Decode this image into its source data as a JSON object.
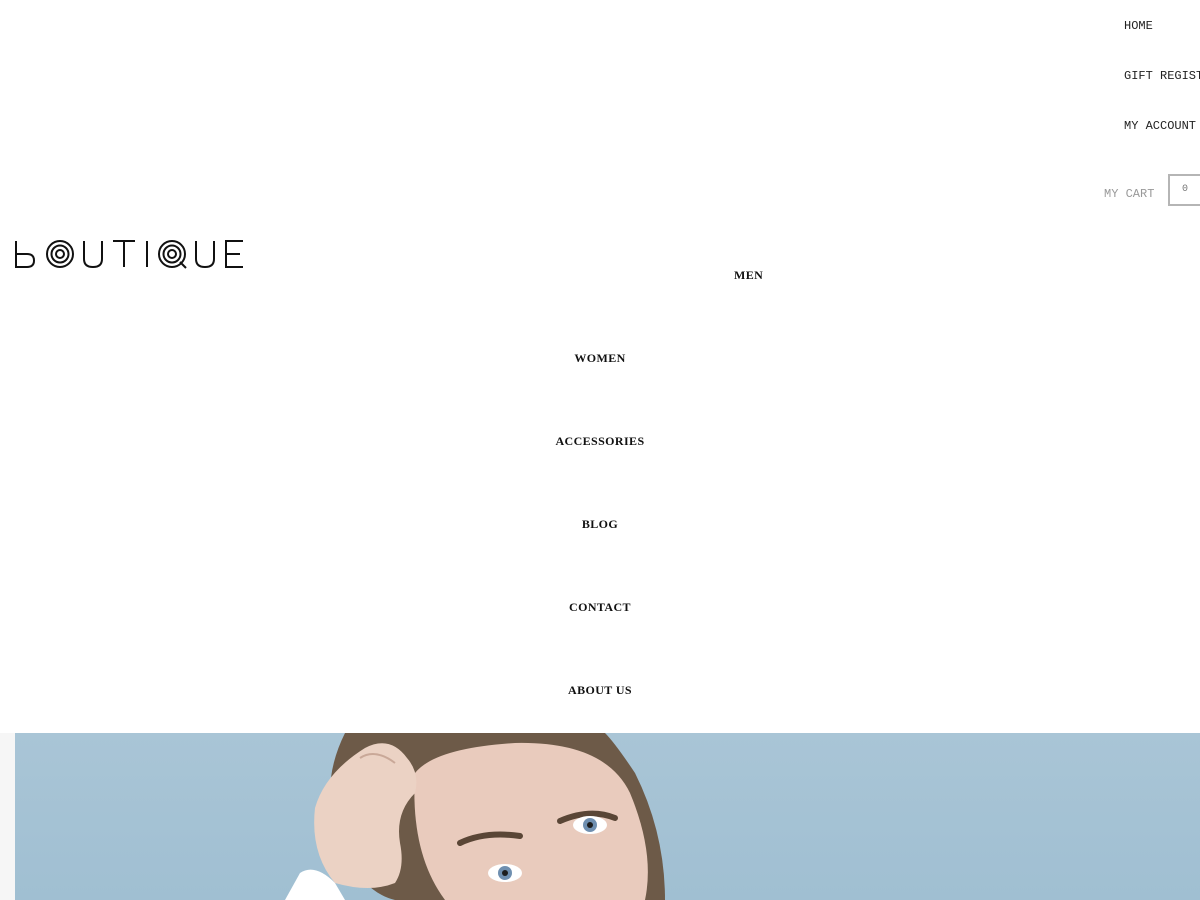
{
  "header": {
    "util_links": [
      "HOME",
      "GIFT REGISTRY",
      "MY ACCOUNT"
    ],
    "cart": {
      "label": "MY CART",
      "count": "0"
    }
  },
  "logo": {
    "text": "BOUTIQUE"
  },
  "main_nav": {
    "items": [
      "MEN",
      "WOMEN",
      "ACCESSORIES",
      "BLOG",
      "CONTACT",
      "ABOUT US"
    ]
  },
  "colors": {
    "hero_sky": "#a9c5d6",
    "cart_border": "#b5b5b5",
    "muted_text": "#999999"
  }
}
